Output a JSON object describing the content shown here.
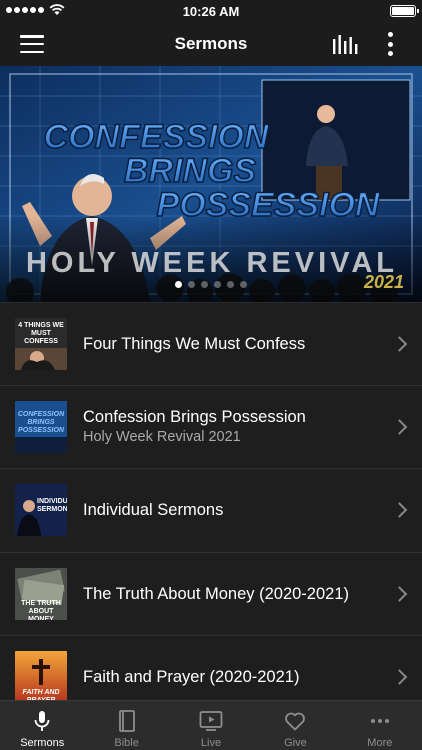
{
  "status_bar": {
    "time": "10:26 AM",
    "signal_dots": 5
  },
  "nav": {
    "title": "Sermons"
  },
  "hero": {
    "line1": "CONFESSION",
    "line2": "BRINGS",
    "line3": "POSSESSION",
    "subtitle": "HOLY WEEK REVIVAL",
    "year": "2021",
    "page_count": 6,
    "active_page": 0
  },
  "sermons": [
    {
      "title": "Four Things We Must Confess",
      "subtitle": "",
      "thumb_text": "4 THINGS WE MUST CONFESS"
    },
    {
      "title": "Confession Brings Possession",
      "subtitle": "Holy Week Revival 2021",
      "thumb_text": "CONFESSION BRINGS POSSESSION"
    },
    {
      "title": "Individual Sermons",
      "subtitle": "",
      "thumb_text": "INDIVIDUAL SERMONS"
    },
    {
      "title": "The Truth About Money (2020-2021)",
      "subtitle": "",
      "thumb_text": "THE TRUTH ABOUT MONEY"
    },
    {
      "title": "Faith and Prayer (2020-2021)",
      "subtitle": "",
      "thumb_text": "FAITH AND PRAYER"
    }
  ],
  "tabs": [
    {
      "label": "Sermons",
      "icon": "microphone-icon",
      "active": true
    },
    {
      "label": "Bible",
      "icon": "book-icon",
      "active": false
    },
    {
      "label": "Live",
      "icon": "tv-play-icon",
      "active": false
    },
    {
      "label": "Give",
      "icon": "heart-icon",
      "active": false
    },
    {
      "label": "More",
      "icon": "ellipsis-icon",
      "active": false
    }
  ],
  "colors": {
    "background": "#1e1e1e",
    "bar": "#1c1c1c",
    "tab_bar": "#2c2c2c",
    "hero_blue": "#1a4f8f",
    "gold": "#c9b24a"
  }
}
